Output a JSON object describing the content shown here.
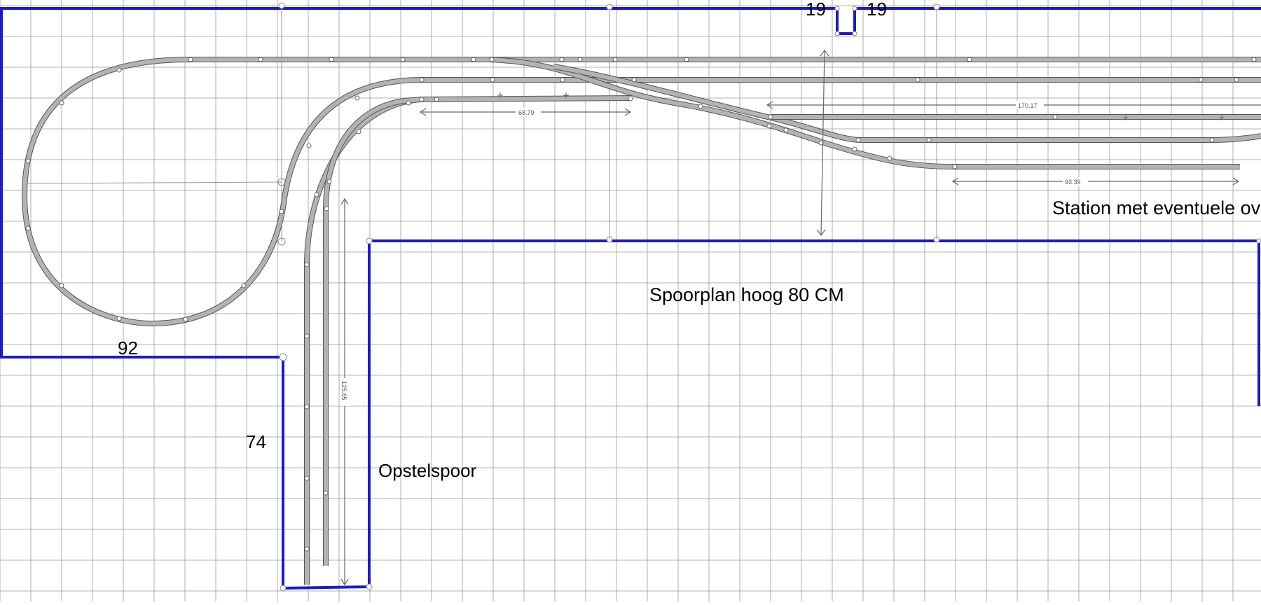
{
  "labels": {
    "top_left_19": "19",
    "top_right_19": "19",
    "dim_92": "92",
    "dim_74": "74",
    "opstelspoor": "Opstelspoor",
    "spoorplan": "Spoorplan hoog 80 CM",
    "station": "Station met eventuele ov"
  },
  "dimensions": {
    "d1": "68.79",
    "d2": "170.17",
    "d3": "93.39",
    "d4": "125.65"
  },
  "colors": {
    "grid": "#9a9a9a",
    "wall": "#1a1acc",
    "rail_fill": "#b3b3b3",
    "rail_stroke": "#555555",
    "dimension": "#666666"
  }
}
